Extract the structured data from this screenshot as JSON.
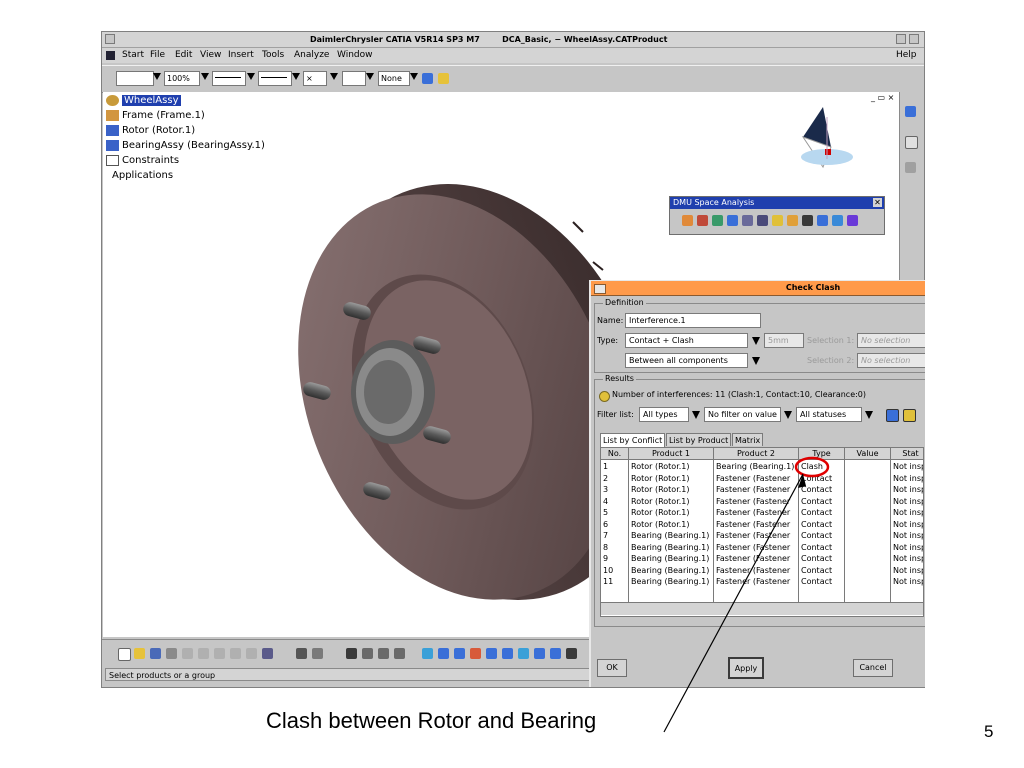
{
  "window": {
    "title": "DaimlerChrysler CATIA V5R14 SP3 M7        DCA_Basic, − WheelAssy.CATProduct"
  },
  "menu": {
    "items": [
      "Start",
      "File",
      "Edit",
      "View",
      "Insert",
      "Tools",
      "Analyze",
      "Window"
    ],
    "help": "Help"
  },
  "toolbar": {
    "zoom": "100%",
    "linetype": "None"
  },
  "tree": {
    "root": "WheelAssy",
    "items": [
      "Frame (Frame.1)",
      "Rotor (Rotor.1)",
      "BearingAssy (BearingAssy.1)",
      "Constraints",
      "Applications"
    ]
  },
  "dmu_toolbar": {
    "title": "DMU Space Analysis",
    "close": "✕"
  },
  "check_clash": {
    "title": "Check Clash",
    "definition_label": "Definition",
    "name_label": "Name:",
    "name_value": "Interference.1",
    "type_label": "Type:",
    "type_value": "Contact + Clash",
    "clearance_value": "5mm",
    "mode_value": "Between all components",
    "selection1_label": "Selection 1:",
    "selection1_value": "No selection",
    "selection2_label": "Selection 2:",
    "selection2_value": "No selection",
    "results_label": "Results",
    "results_summary": "Number of interferences: 11 (Clash:1, Contact:10, Clearance:0)",
    "filter_label": "Filter list:",
    "filter_types": "All types",
    "filter_value": "No filter on value",
    "filter_status": "All statuses",
    "tabs": [
      "List by Conflict",
      "List by Product",
      "Matrix"
    ],
    "columns": [
      "No.",
      "Product 1",
      "Product 2",
      "Type",
      "Value",
      "Stat"
    ],
    "rows": [
      {
        "no": "1",
        "p1": "Rotor (Rotor.1)",
        "p2": "Bearing (Bearing.1)",
        "type": "Clash",
        "value": "",
        "status": "Not insp"
      },
      {
        "no": "2",
        "p1": "Rotor (Rotor.1)",
        "p2": "Fastener (Fastener",
        "type": "Contact",
        "value": "",
        "status": "Not insp"
      },
      {
        "no": "3",
        "p1": "Rotor (Rotor.1)",
        "p2": "Fastener (Fastener",
        "type": "Contact",
        "value": "",
        "status": "Not insp"
      },
      {
        "no": "4",
        "p1": "Rotor (Rotor.1)",
        "p2": "Fastener (Fastener",
        "type": "Contact",
        "value": "",
        "status": "Not insp"
      },
      {
        "no": "5",
        "p1": "Rotor (Rotor.1)",
        "p2": "Fastener (Fastener",
        "type": "Contact",
        "value": "",
        "status": "Not insp"
      },
      {
        "no": "6",
        "p1": "Rotor (Rotor.1)",
        "p2": "Fastener (Fastener",
        "type": "Contact",
        "value": "",
        "status": "Not insp"
      },
      {
        "no": "7",
        "p1": "Bearing (Bearing.1)",
        "p2": "Fastener (Fastener",
        "type": "Contact",
        "value": "",
        "status": "Not insp"
      },
      {
        "no": "8",
        "p1": "Bearing (Bearing.1)",
        "p2": "Fastener (Fastener",
        "type": "Contact",
        "value": "",
        "status": "Not insp"
      },
      {
        "no": "9",
        "p1": "Bearing (Bearing.1)",
        "p2": "Fastener (Fastener",
        "type": "Contact",
        "value": "",
        "status": "Not insp"
      },
      {
        "no": "10",
        "p1": "Bearing (Bearing.1)",
        "p2": "Fastener (Fastener",
        "type": "Contact",
        "value": "",
        "status": "Not insp"
      },
      {
        "no": "11",
        "p1": "Bearing (Bearing.1)",
        "p2": "Fastener (Fastener",
        "type": "Contact",
        "value": "",
        "status": "Not insp"
      }
    ],
    "ok_label": "OK",
    "apply_label": "Apply",
    "cancel_label": "Cancel"
  },
  "status": {
    "text": "Select products or a group"
  },
  "slide": {
    "caption": "Clash between Rotor and Bearing",
    "page_number": "5"
  },
  "colors": {
    "rotor": "#6f5a5a",
    "selection": "#1f3fae",
    "dialog_header": "#ff9a4a",
    "highlight": "#e00000"
  }
}
